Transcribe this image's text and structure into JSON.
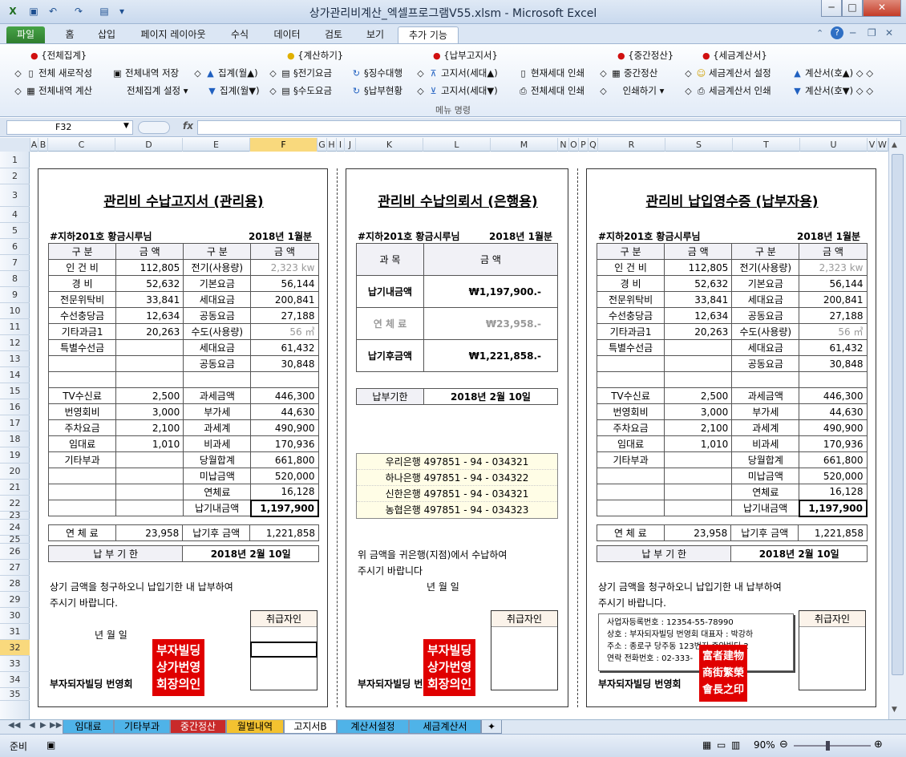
{
  "window": {
    "title": "상가관리비계산_엑셀프로그램V55.xlsm  -  Microsoft Excel",
    "buttons": {
      "minimize": "─",
      "maximize": "□",
      "close": "✕"
    }
  },
  "tabs": {
    "file": "파일",
    "home": "홈",
    "insert": "삽입",
    "page_layout": "페이지 레이아웃",
    "formulas": "수식",
    "data": "데이터",
    "review": "검토",
    "view": "보기",
    "addins": "추가 기능"
  },
  "ribbon": {
    "groups": {
      "g1": "{전체집계}",
      "g2": "{계산하기}",
      "g3": "{납부고지서}",
      "g4": "{중간정산}",
      "g5": "{세금계산서}"
    },
    "cmd": {
      "total_new": "전체 새로작성",
      "total_save": "전체내역 저장",
      "agg_up": "집계(월▲)",
      "total_calc": "전체내역 계산",
      "total_setting": "전체집계 설정",
      "agg_down": "집계(월▼)",
      "elec_fee": "§전기요금",
      "collect_target": "§징수대행",
      "water_fee": "§수도요금",
      "pay_status": "§납부현황",
      "bill_up": "고지서(세대▲)",
      "bill_down": "고지서(세대▼)",
      "print_current": "현재세대 인쇄",
      "print_all": "전체세대 인쇄",
      "mid_settle": "중간정산",
      "print_it": "인쇄하기",
      "tax_setting": "세금계산서 설정",
      "tax_print": "세금계산서 인쇄",
      "calc_up": "계산서(호▲)",
      "calc_down": "계산서(호▼)"
    },
    "group_label": "메뉴 명령"
  },
  "formula_bar": {
    "namebox": "F32",
    "fx": "fx",
    "formula": ""
  },
  "columns": [
    "A",
    "B",
    "C",
    "D",
    "E",
    "F",
    "G",
    "H",
    "I",
    "J",
    "K",
    "L",
    "M",
    "N",
    "O",
    "P",
    "Q",
    "R",
    "S",
    "T",
    "U",
    "V",
    "W"
  ],
  "rows": [
    "1",
    "2",
    "3",
    "4",
    "5",
    "6",
    "7",
    "8",
    "9",
    "10",
    "11",
    "12",
    "13",
    "14",
    "15",
    "16",
    "17",
    "18",
    "19",
    "20",
    "21",
    "22",
    "23",
    "24",
    "25",
    "26",
    "27",
    "28",
    "29",
    "30",
    "31",
    "32",
    "33",
    "34",
    "35"
  ],
  "bill": {
    "title_mgmt": "관리비 수납고지서 (관리용)",
    "title_bank": "관리비 수납의뢰서 (은행용)",
    "title_payer": "관리비 납입영수증 (납부자용)",
    "unit": "#지하201호 황금시루님",
    "month": "2018년 1월분",
    "col_gubun": "구  분",
    "col_amount": "금  액",
    "left_rows": [
      [
        "인 건 비",
        "112,805"
      ],
      [
        "경      비",
        "52,632"
      ],
      [
        "전문위탁비",
        "33,841"
      ],
      [
        "수선충당금",
        "12,634"
      ],
      [
        "기타과금1",
        "20,263"
      ],
      [
        "특별수선금",
        ""
      ],
      [
        "",
        ""
      ],
      [
        "",
        ""
      ],
      [
        "TV수신료",
        "2,500"
      ],
      [
        "번영회비",
        "3,000"
      ],
      [
        "주차요금",
        "2,100"
      ],
      [
        "임대료",
        "1,010"
      ],
      [
        "기타부과",
        ""
      ],
      [
        "",
        ""
      ],
      [
        "",
        ""
      ],
      [
        "",
        ""
      ]
    ],
    "right_rows": [
      [
        "전기(사용량)",
        "2,323  kw"
      ],
      [
        "기본요금",
        "56,144"
      ],
      [
        "세대요금",
        "200,841"
      ],
      [
        "공동요금",
        "27,188"
      ],
      [
        "수도(사용량)",
        "56  ㎥"
      ],
      [
        "세대요금",
        "61,432"
      ],
      [
        "공동요금",
        "30,848"
      ],
      [
        "",
        ""
      ],
      [
        "과세금액",
        "446,300"
      ],
      [
        "부가세",
        "44,630"
      ],
      [
        "과세계",
        "490,900"
      ],
      [
        "비과세",
        "170,936"
      ],
      [
        "당월합계",
        "661,800"
      ],
      [
        "미납금액",
        "520,000"
      ],
      [
        "연체료",
        "16,128"
      ],
      [
        "납기내금액",
        "1,197,900"
      ]
    ],
    "late_label": "연  체  료",
    "late_amount": "23,958",
    "after_label": "납기후 금액",
    "after_amount": "1,221,858",
    "due_label": "납  부  기  한",
    "due_date": "2018년 2월 10일",
    "notice1": "상기 금액을 청구하오니 납입기한 내 납부하여",
    "notice2": "주시기 바랍니다.",
    "ymd": "년      월      일",
    "handler": "취급자인",
    "org": "부자되자빌딩 번영회",
    "stamp": [
      "부자빌딩",
      "상가번영",
      "회장의인"
    ],
    "bank": {
      "col_item": "과     목",
      "col_amount": "금     액",
      "in_label": "납기내금액",
      "in_amount": "₩1,197,900.-",
      "late_label": "연   체   료",
      "late_amount": "₩23,958.-",
      "after_label": "납기후금액",
      "after_amount": "₩1,221,858.-",
      "due_label": "납부기한",
      "due_date": "2018년 2월 10일",
      "accounts": [
        "우리은행  497851 - 94 - 034321",
        "하나은행  497851 - 94 - 034322",
        "신한은행  497851 - 94 - 034321",
        "농협은행  497851 - 94 - 034323"
      ],
      "req1": "위 금액을 귀은행(지점)에서 수납하여",
      "req2": "주시기 바랍니다",
      "ymd": "년      월      일"
    },
    "official": [
      "사업자등록번호 : 12354-55-78990",
      "상호 : 부자되자빌딩 번영회  대표자 : 박강하",
      "주소 : 종로구 당주동 123번지 중앙빌딩 2",
      "연락 전화번호 : 02-333-"
    ],
    "seal": [
      "富者建物",
      "商街繁榮",
      "會長之印"
    ]
  },
  "sheet_tabs": [
    "임대료",
    "기타부과",
    "중간정산",
    "월별내역",
    "고지서B",
    "계산서설정",
    "세금계산서"
  ],
  "status": {
    "ready": "준비",
    "zoom": "90%"
  }
}
